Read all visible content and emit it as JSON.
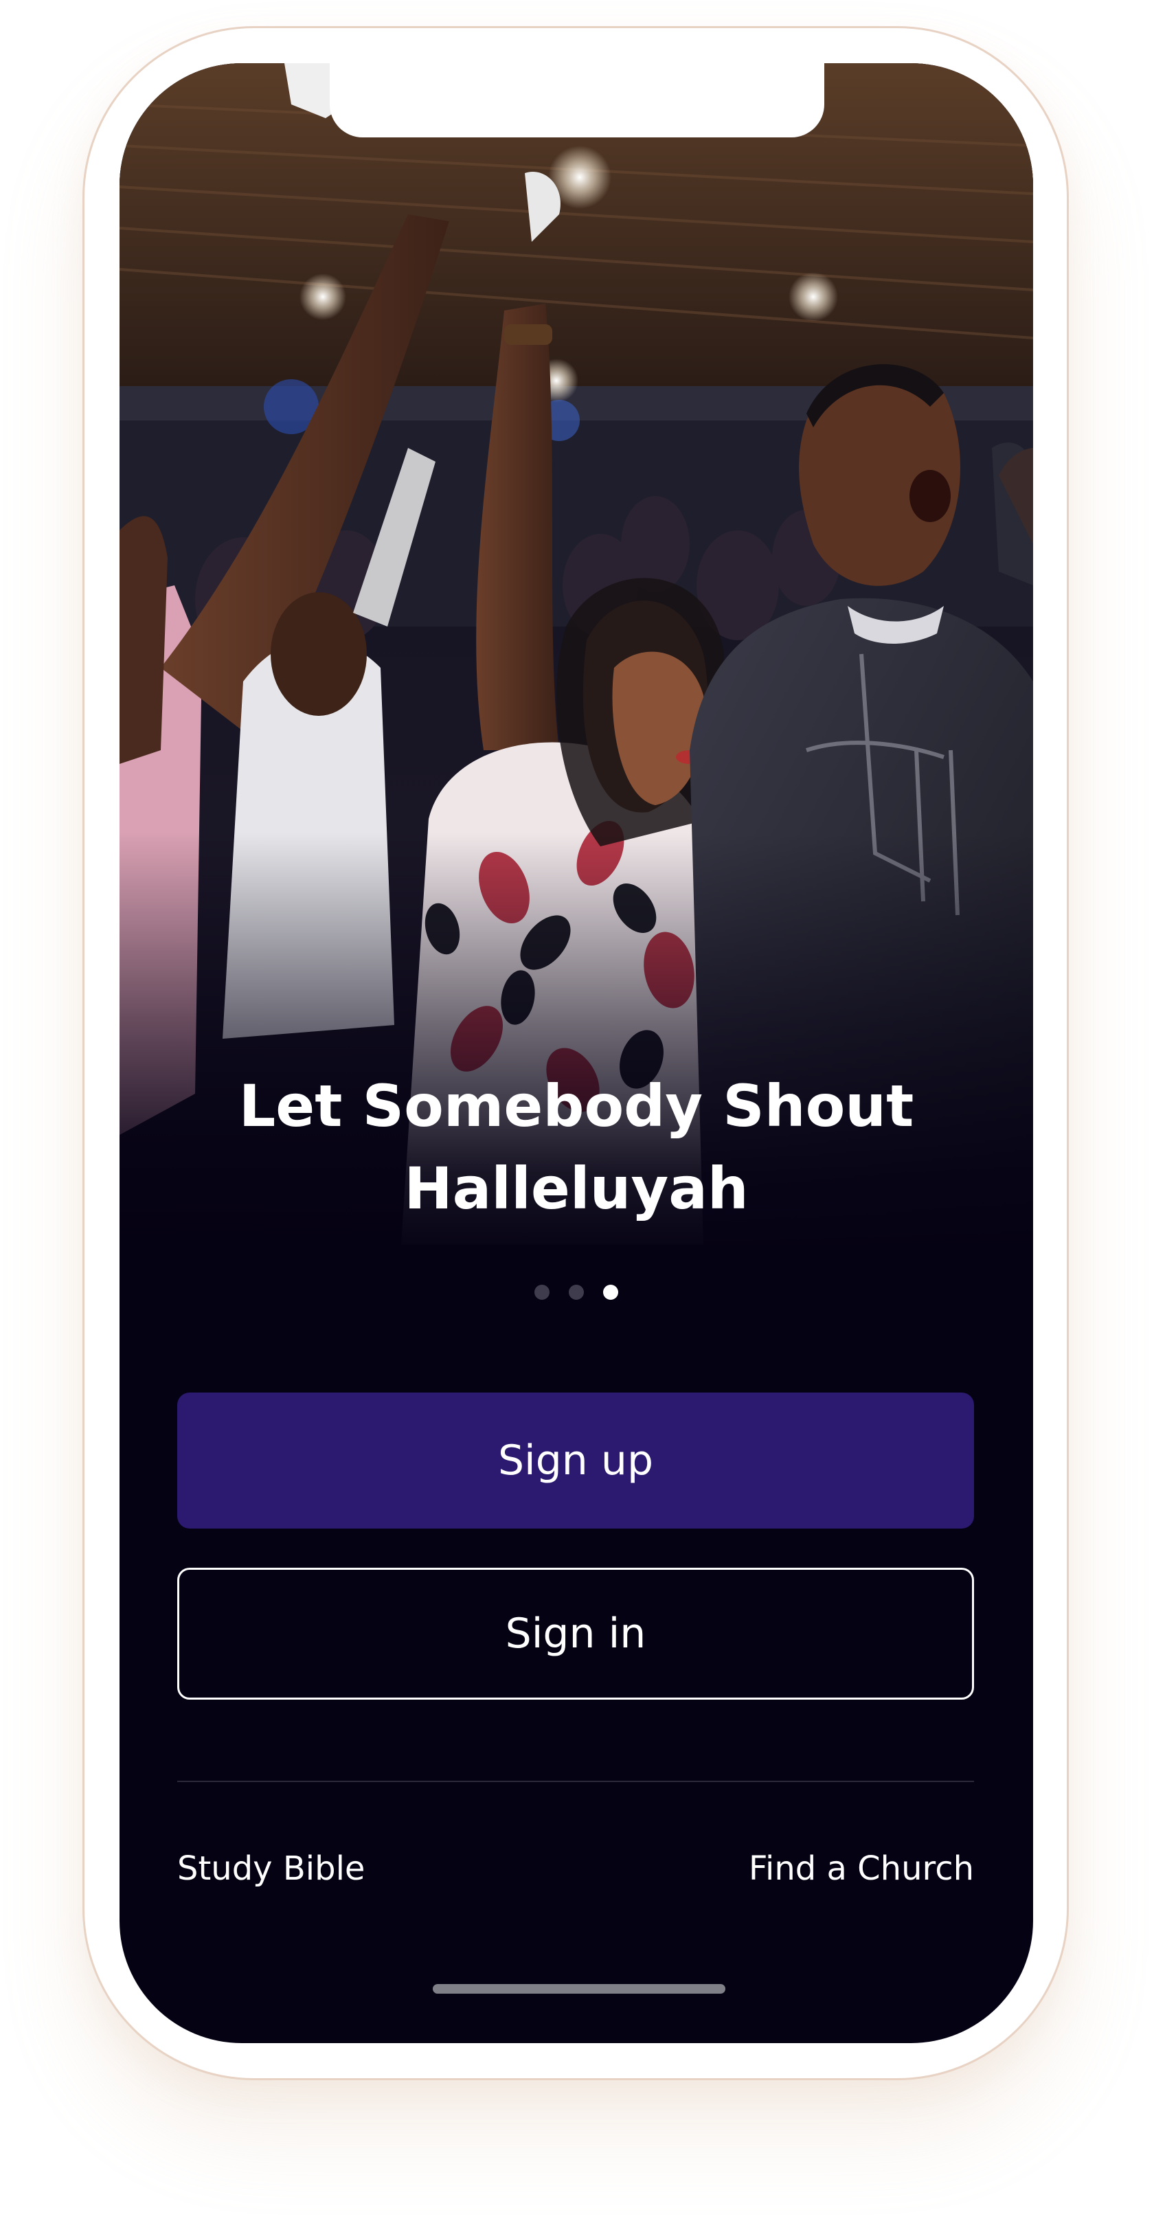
{
  "onboarding": {
    "headline_line1": "Let Somebody Shout",
    "headline_line2": "Halleluyah",
    "carousel": {
      "total": 3,
      "active_index": 2
    },
    "sign_up_label": "Sign up",
    "sign_in_label": "Sign in",
    "study_bible_label": "Study Bible",
    "find_church_label": "Find a Church"
  },
  "colors": {
    "background": "#050214",
    "primary_button": "#2c1970",
    "text": "#ffffff",
    "inactive_dot": "#3f3c4e"
  },
  "photo": {
    "icon": "worship-crowd-photo"
  }
}
